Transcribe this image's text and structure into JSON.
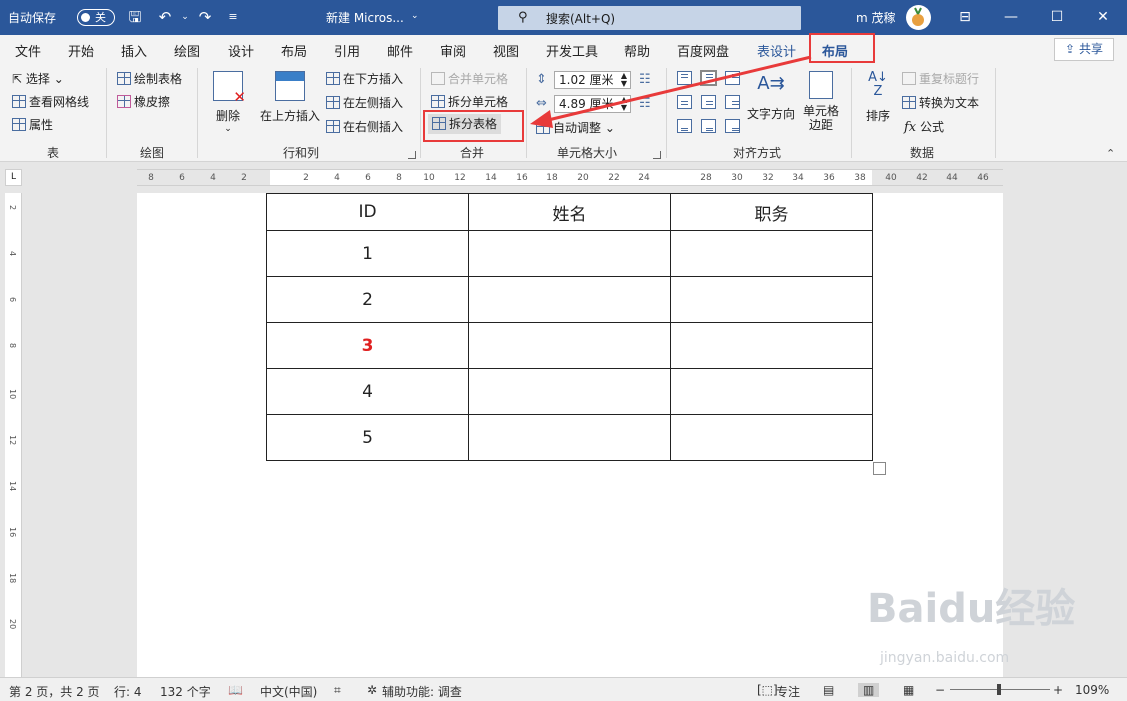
{
  "titlebar": {
    "autosave_label": "自动保存",
    "autosave_state": "关",
    "doc_title": "新建 Micros...",
    "search_placeholder": "搜索(Alt+Q)",
    "user_name": "m 茂稼"
  },
  "tabs": [
    {
      "label": "文件"
    },
    {
      "label": "开始"
    },
    {
      "label": "插入"
    },
    {
      "label": "绘图"
    },
    {
      "label": "设计"
    },
    {
      "label": "布局"
    },
    {
      "label": "引用"
    },
    {
      "label": "邮件"
    },
    {
      "label": "审阅"
    },
    {
      "label": "视图"
    },
    {
      "label": "开发工具"
    },
    {
      "label": "帮助"
    },
    {
      "label": "百度网盘"
    },
    {
      "label": "表设计"
    },
    {
      "label": "布局"
    }
  ],
  "share_label": "共享",
  "ribbon": {
    "table_group": {
      "label": "表",
      "select": "选择",
      "view_gridlines": "查看网格线",
      "properties": "属性"
    },
    "draw_group": {
      "label": "绘图",
      "draw_table": "绘制表格",
      "eraser": "橡皮擦"
    },
    "rows_cols_group": {
      "label": "行和列",
      "delete": "删除",
      "insert_above": "在上方插入",
      "insert_below": "在下方插入",
      "insert_left": "在左侧插入",
      "insert_right": "在右侧插入"
    },
    "merge_group": {
      "label": "合并",
      "merge_cells": "合并单元格",
      "split_cells": "拆分单元格",
      "split_table": "拆分表格"
    },
    "cell_size_group": {
      "label": "单元格大小",
      "height": "1.02 厘米",
      "width": "4.89 厘米",
      "autofit": "自动调整"
    },
    "alignment_group": {
      "label": "对齐方式",
      "text_direction": "文字方向",
      "cell_margins_1": "单元格",
      "cell_margins_2": "边距"
    },
    "data_group": {
      "label": "数据",
      "sort": "排序",
      "repeat_header": "重复标题行",
      "convert_to_text": "转换为文本",
      "formula": "公式"
    }
  },
  "ruler_h": [
    "8",
    "6",
    "4",
    "2",
    "2",
    "4",
    "6",
    "8",
    "10",
    "12",
    "14",
    "16",
    "18",
    "20",
    "22",
    "24",
    "28",
    "30",
    "32",
    "34",
    "36",
    "38",
    "40",
    "42",
    "44",
    "46"
  ],
  "ruler_v": [
    "2",
    "4",
    "6",
    "8",
    "10",
    "12",
    "14",
    "16",
    "18",
    "20"
  ],
  "table": {
    "header": [
      "ID",
      "姓名",
      "职务"
    ],
    "rows": [
      [
        "1",
        "",
        ""
      ],
      [
        "2",
        "",
        ""
      ],
      [
        "3",
        "",
        ""
      ],
      [
        "4",
        "",
        ""
      ],
      [
        "5",
        "",
        ""
      ]
    ]
  },
  "statusbar": {
    "page": "第 2 页，共 2 页",
    "line": "行: 4",
    "words": "132 个字",
    "language": "中文(中国)",
    "accessibility": "辅助功能: 调查",
    "focus": "专注",
    "zoom": "109%"
  },
  "watermark": {
    "brand": "Baidu经验",
    "url": "jingyan.baidu.com"
  },
  "colors": {
    "title_blue": "#2b579a",
    "highlight_red": "#e83a3a",
    "cell_red": "#e02020"
  }
}
